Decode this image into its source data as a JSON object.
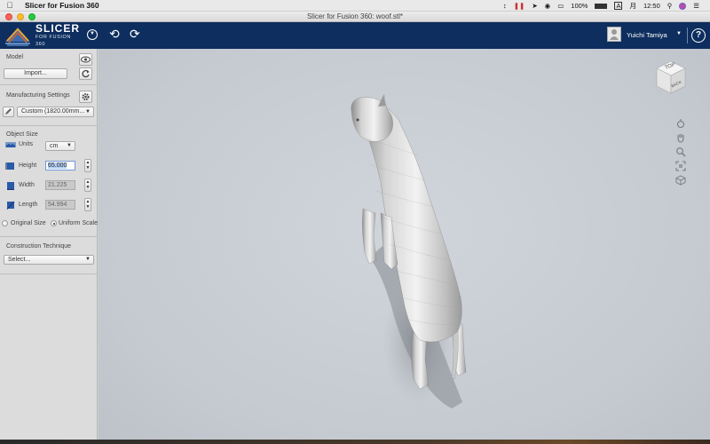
{
  "menubar": {
    "app_name": "Slicer for Fusion 360",
    "battery": "100%",
    "input_source": "A",
    "date": "月",
    "time": "12:50"
  },
  "window": {
    "title": "Slicer for Fusion 360: woof.stl*"
  },
  "header": {
    "logo_line1": "SLICER",
    "logo_line2": "FOR FUSION 360",
    "user_name": "Yuichi Tamiya",
    "help_label": "?"
  },
  "panel": {
    "model": {
      "label": "Model",
      "import_label": "Import..."
    },
    "manufacturing": {
      "label": "Manufacturing Settings",
      "selected": "Custom (1820.00mm..."
    },
    "object_size": {
      "label": "Object Size",
      "units_label": "Units",
      "units_value": "cm",
      "height_label": "Height",
      "height_value": "65.000",
      "width_label": "Width",
      "width_value": "21.225",
      "length_label": "Length",
      "length_value": "54.994",
      "original_size_label": "Original Size",
      "uniform_scale_label": "Uniform Scale"
    },
    "construction": {
      "label": "Construction Technique",
      "selected": "Select..."
    }
  },
  "viewcube": {
    "top_label": "TOP",
    "back_label": "BACK"
  },
  "colors": {
    "header_bg": "#0d2e5e",
    "panel_bg": "#dcdcdc",
    "viewport_bg": "#c9ced4"
  }
}
